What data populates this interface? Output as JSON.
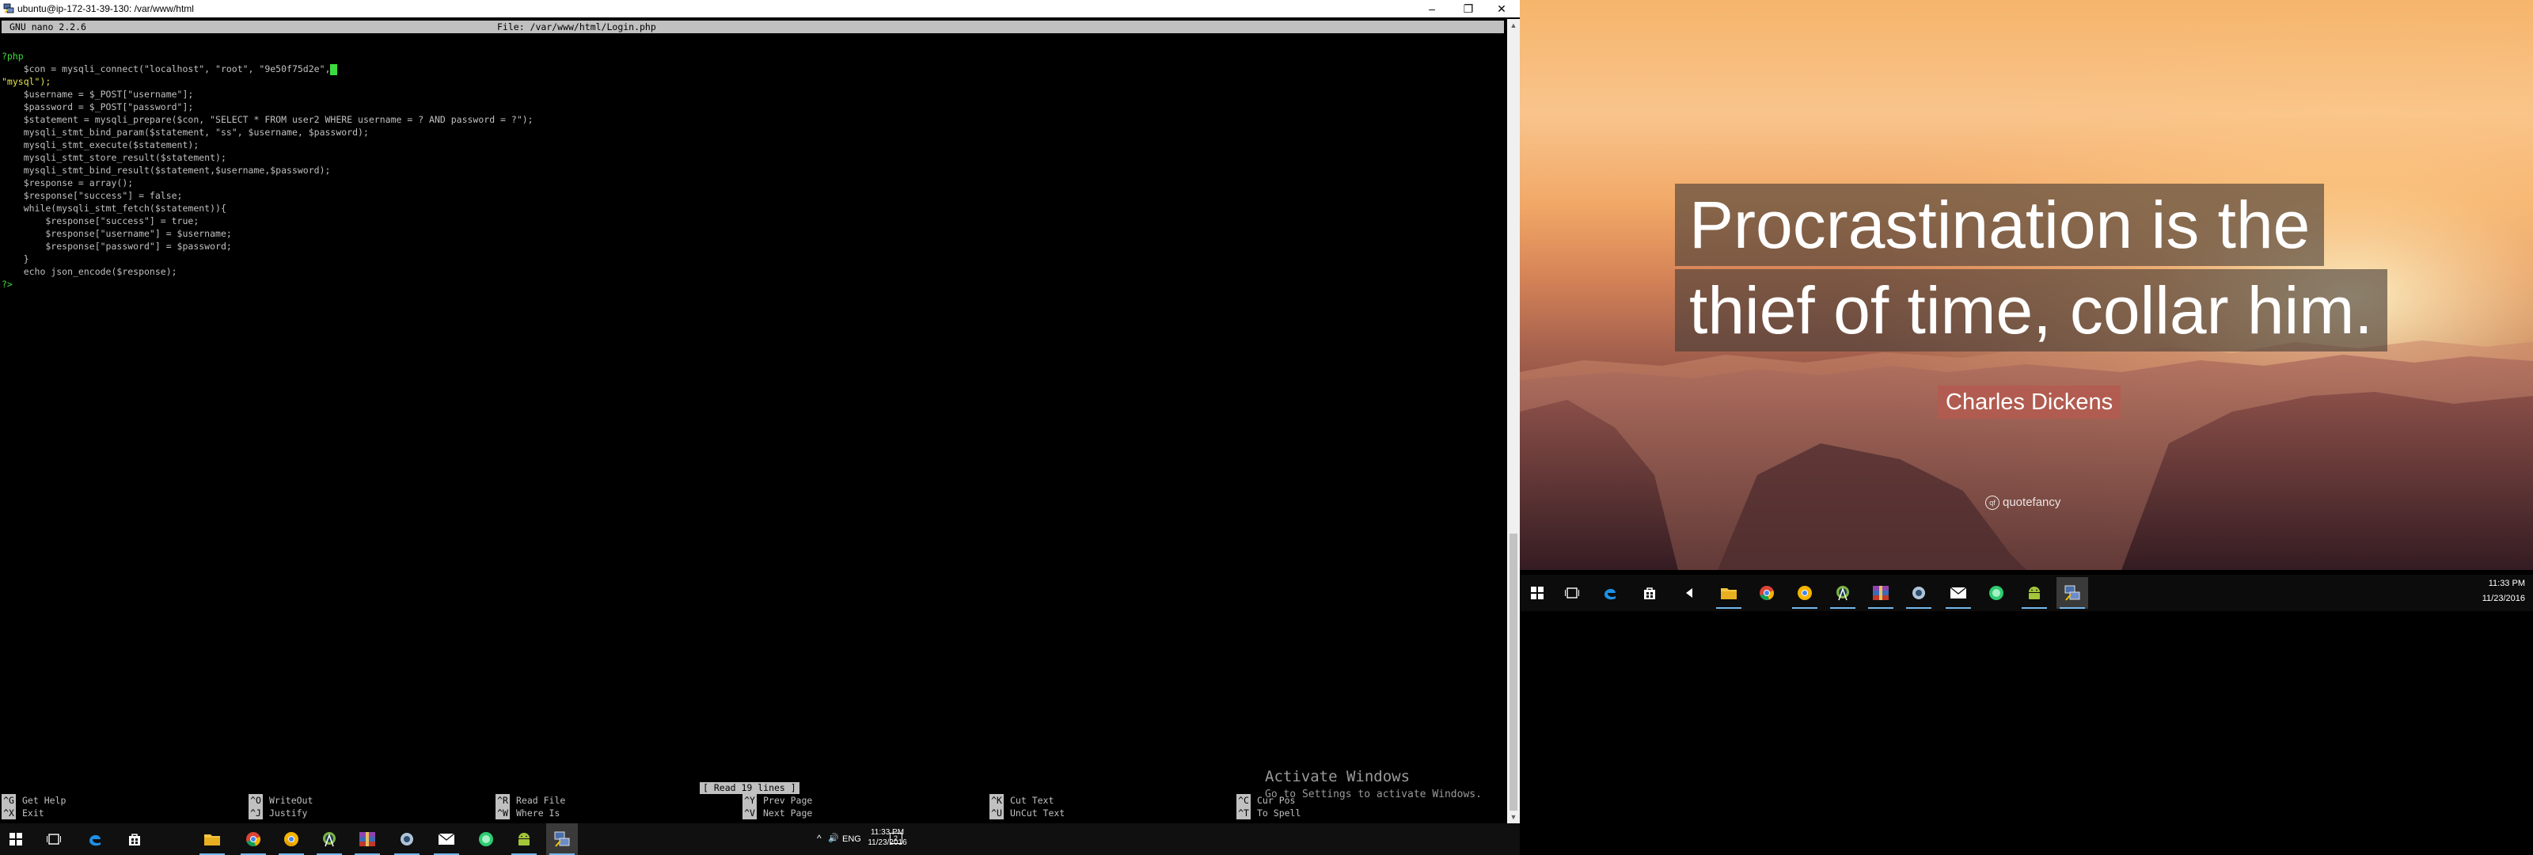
{
  "left_window": {
    "title": "ubuntu@ip-172-31-39-130: /var/www/html",
    "controls": {
      "minimize": "–",
      "restore": "❐",
      "close": "✕"
    }
  },
  "nano": {
    "version": "GNU nano 2.2.6",
    "file": "File: /var/www/html/Login.php",
    "lines": [
      "?php",
      "    $con = mysqli_connect(\"localhost\", \"root\", \"9e50f75d2e\",",
      "\"mysql\");",
      "    $username = $_POST[\"username\"];",
      "    $password = $_POST[\"password\"];",
      "    $statement = mysqli_prepare($con, \"SELECT * FROM user2 WHERE username = ? AND password = ?\");",
      "    mysqli_stmt_bind_param($statement, \"ss\", $username, $password);",
      "    mysqli_stmt_execute($statement);",
      "    mysqli_stmt_store_result($statement);",
      "    mysqli_stmt_bind_result($statement,$username,$password);",
      "    $response = array();",
      "    $response[\"success\"] = false;",
      "    while(mysqli_stmt_fetch($statement)){",
      "        $response[\"success\"] = true;",
      "        $response[\"username\"] = $username;",
      "        $response[\"password\"] = $password;",
      "    }",
      "    echo json_encode($response);",
      "?>"
    ],
    "status": "[ Read 19 lines ]",
    "shortcuts": [
      {
        "key": "^G",
        "label": "Get Help"
      },
      {
        "key": "^X",
        "label": "Exit"
      },
      {
        "key": "^O",
        "label": "WriteOut"
      },
      {
        "key": "^J",
        "label": "Justify"
      },
      {
        "key": "^R",
        "label": "Read File"
      },
      {
        "key": "^W",
        "label": "Where Is"
      },
      {
        "key": "^Y",
        "label": "Prev Page"
      },
      {
        "key": "^V",
        "label": "Next Page"
      },
      {
        "key": "^K",
        "label": "Cut Text"
      },
      {
        "key": "^U",
        "label": "UnCut Text"
      },
      {
        "key": "^C",
        "label": "Cur Pos"
      },
      {
        "key": "^T",
        "label": "To Spell"
      }
    ]
  },
  "watermark": {
    "line1": "Activate Windows",
    "line2": "Go to Settings to activate Windows."
  },
  "taskbar_left": {
    "icons": [
      "start-icon",
      "task-view-icon",
      "edge-icon",
      "store-icon",
      "file-explorer-icon",
      "chrome-icon",
      "chrome-canary-icon",
      "android-studio-icon",
      "winrar-icon",
      "app-icon",
      "mail-icon",
      "green-app-icon",
      "android-icon",
      "putty-icon"
    ],
    "tray": {
      "chevron": "^",
      "volume": "🔊",
      "language": "ENG",
      "time": "11:33 PM",
      "date": "11/23/2016",
      "notifications": "2"
    }
  },
  "taskbar_right": {
    "icons": [
      "start-icon",
      "task-view-icon",
      "edge-icon",
      "store-icon",
      "media-icon",
      "file-explorer-icon",
      "chrome-icon",
      "chrome-canary-icon",
      "android-studio-icon",
      "winrar-icon",
      "app-icon",
      "mail-icon",
      "green-app-icon",
      "android-icon",
      "putty-icon"
    ],
    "time": "11:33 PM",
    "date": "11/23/2016"
  },
  "wallpaper": {
    "quote_line1": "Procrastination is the",
    "quote_line2": "thief of time, collar him.",
    "author": "Charles Dickens",
    "brand": "quotefancy",
    "brand_logo": "qf"
  },
  "colors": {
    "terminal_bg": "#000000",
    "terminal_text": "#c0c0c0",
    "string": "#e6e64c",
    "green": "#3ddc3d",
    "taskbar": "#101010",
    "accent": "#76b9ed"
  }
}
